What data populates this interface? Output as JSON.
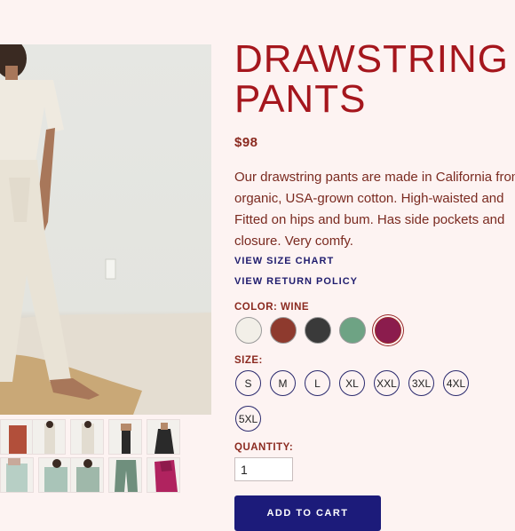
{
  "product": {
    "title": "DRAWSTRING PANTS",
    "price": "$98",
    "description": "Our drawstring pants are made in California from\norganic, USA-grown cotton. High-waisted and\nFitted on hips and bum. Has side pockets and\nclosure. Very comfy."
  },
  "links": {
    "size_chart": "VIEW SIZE CHART",
    "return_policy": "VIEW RETURN POLICY"
  },
  "color": {
    "label": "COLOR: WINE",
    "options": [
      {
        "name": "natural",
        "hex": "#f2efe8"
      },
      {
        "name": "rust",
        "hex": "#8e3a2e"
      },
      {
        "name": "black",
        "hex": "#3a3a3a"
      },
      {
        "name": "sage",
        "hex": "#6ea384"
      },
      {
        "name": "wine",
        "hex": "#8b1c4d",
        "selected": true
      }
    ]
  },
  "size": {
    "label": "SIZE:",
    "options": [
      "S",
      "M",
      "L",
      "XL",
      "XXL",
      "3XL",
      "4XL",
      "5XL"
    ]
  },
  "quantity": {
    "label": "QUANTITY:",
    "value": "1"
  },
  "cart": {
    "label": "ADD TO CART"
  },
  "thumbnails": [
    {
      "name": "rust-pants-photo",
      "color": "#b24f3a"
    },
    {
      "name": "natural-pants-front-photo",
      "color": "#e9e4da"
    },
    {
      "name": "natural-pants-side-photo",
      "color": "#e9e4da"
    },
    {
      "name": "black-pants-front-photo",
      "color": "#2a2a2a"
    },
    {
      "name": "black-pants-side-photo",
      "color": "#2a2a2a"
    },
    {
      "name": "sage-set-photo",
      "color": "#9bb8ad"
    },
    {
      "name": "sage-top-photo",
      "color": "#9bb8ad"
    },
    {
      "name": "sage-seated-photo",
      "color": "#8fa99b"
    },
    {
      "name": "sage-pants-flat-photo",
      "color": "#6f8f7d"
    },
    {
      "name": "wine-pants-flat-photo",
      "color": "#b0235f"
    }
  ],
  "colors": {
    "title": "#a5161d",
    "text": "#7a2a20",
    "link": "#1f1c6e",
    "button": "#1c1b7a",
    "background": "#fdf3f2"
  }
}
